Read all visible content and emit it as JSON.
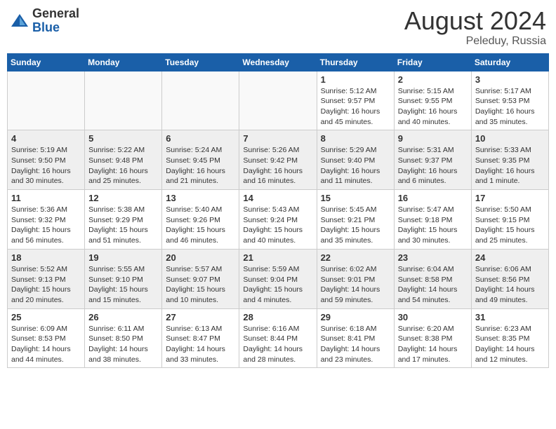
{
  "header": {
    "logo": {
      "general": "General",
      "blue": "Blue"
    },
    "title": "August 2024",
    "subtitle": "Peleduy, Russia"
  },
  "calendar": {
    "weekdays": [
      "Sunday",
      "Monday",
      "Tuesday",
      "Wednesday",
      "Thursday",
      "Friday",
      "Saturday"
    ],
    "weeks": [
      [
        {
          "day": "",
          "info": ""
        },
        {
          "day": "",
          "info": ""
        },
        {
          "day": "",
          "info": ""
        },
        {
          "day": "",
          "info": ""
        },
        {
          "day": "1",
          "info": "Sunrise: 5:12 AM\nSunset: 9:57 PM\nDaylight: 16 hours\nand 45 minutes."
        },
        {
          "day": "2",
          "info": "Sunrise: 5:15 AM\nSunset: 9:55 PM\nDaylight: 16 hours\nand 40 minutes."
        },
        {
          "day": "3",
          "info": "Sunrise: 5:17 AM\nSunset: 9:53 PM\nDaylight: 16 hours\nand 35 minutes."
        }
      ],
      [
        {
          "day": "4",
          "info": "Sunrise: 5:19 AM\nSunset: 9:50 PM\nDaylight: 16 hours\nand 30 minutes."
        },
        {
          "day": "5",
          "info": "Sunrise: 5:22 AM\nSunset: 9:48 PM\nDaylight: 16 hours\nand 25 minutes."
        },
        {
          "day": "6",
          "info": "Sunrise: 5:24 AM\nSunset: 9:45 PM\nDaylight: 16 hours\nand 21 minutes."
        },
        {
          "day": "7",
          "info": "Sunrise: 5:26 AM\nSunset: 9:42 PM\nDaylight: 16 hours\nand 16 minutes."
        },
        {
          "day": "8",
          "info": "Sunrise: 5:29 AM\nSunset: 9:40 PM\nDaylight: 16 hours\nand 11 minutes."
        },
        {
          "day": "9",
          "info": "Sunrise: 5:31 AM\nSunset: 9:37 PM\nDaylight: 16 hours\nand 6 minutes."
        },
        {
          "day": "10",
          "info": "Sunrise: 5:33 AM\nSunset: 9:35 PM\nDaylight: 16 hours\nand 1 minute."
        }
      ],
      [
        {
          "day": "11",
          "info": "Sunrise: 5:36 AM\nSunset: 9:32 PM\nDaylight: 15 hours\nand 56 minutes."
        },
        {
          "day": "12",
          "info": "Sunrise: 5:38 AM\nSunset: 9:29 PM\nDaylight: 15 hours\nand 51 minutes."
        },
        {
          "day": "13",
          "info": "Sunrise: 5:40 AM\nSunset: 9:26 PM\nDaylight: 15 hours\nand 46 minutes."
        },
        {
          "day": "14",
          "info": "Sunrise: 5:43 AM\nSunset: 9:24 PM\nDaylight: 15 hours\nand 40 minutes."
        },
        {
          "day": "15",
          "info": "Sunrise: 5:45 AM\nSunset: 9:21 PM\nDaylight: 15 hours\nand 35 minutes."
        },
        {
          "day": "16",
          "info": "Sunrise: 5:47 AM\nSunset: 9:18 PM\nDaylight: 15 hours\nand 30 minutes."
        },
        {
          "day": "17",
          "info": "Sunrise: 5:50 AM\nSunset: 9:15 PM\nDaylight: 15 hours\nand 25 minutes."
        }
      ],
      [
        {
          "day": "18",
          "info": "Sunrise: 5:52 AM\nSunset: 9:13 PM\nDaylight: 15 hours\nand 20 minutes."
        },
        {
          "day": "19",
          "info": "Sunrise: 5:55 AM\nSunset: 9:10 PM\nDaylight: 15 hours\nand 15 minutes."
        },
        {
          "day": "20",
          "info": "Sunrise: 5:57 AM\nSunset: 9:07 PM\nDaylight: 15 hours\nand 10 minutes."
        },
        {
          "day": "21",
          "info": "Sunrise: 5:59 AM\nSunset: 9:04 PM\nDaylight: 15 hours\nand 4 minutes."
        },
        {
          "day": "22",
          "info": "Sunrise: 6:02 AM\nSunset: 9:01 PM\nDaylight: 14 hours\nand 59 minutes."
        },
        {
          "day": "23",
          "info": "Sunrise: 6:04 AM\nSunset: 8:58 PM\nDaylight: 14 hours\nand 54 minutes."
        },
        {
          "day": "24",
          "info": "Sunrise: 6:06 AM\nSunset: 8:56 PM\nDaylight: 14 hours\nand 49 minutes."
        }
      ],
      [
        {
          "day": "25",
          "info": "Sunrise: 6:09 AM\nSunset: 8:53 PM\nDaylight: 14 hours\nand 44 minutes."
        },
        {
          "day": "26",
          "info": "Sunrise: 6:11 AM\nSunset: 8:50 PM\nDaylight: 14 hours\nand 38 minutes."
        },
        {
          "day": "27",
          "info": "Sunrise: 6:13 AM\nSunset: 8:47 PM\nDaylight: 14 hours\nand 33 minutes."
        },
        {
          "day": "28",
          "info": "Sunrise: 6:16 AM\nSunset: 8:44 PM\nDaylight: 14 hours\nand 28 minutes."
        },
        {
          "day": "29",
          "info": "Sunrise: 6:18 AM\nSunset: 8:41 PM\nDaylight: 14 hours\nand 23 minutes."
        },
        {
          "day": "30",
          "info": "Sunrise: 6:20 AM\nSunset: 8:38 PM\nDaylight: 14 hours\nand 17 minutes."
        },
        {
          "day": "31",
          "info": "Sunrise: 6:23 AM\nSunset: 8:35 PM\nDaylight: 14 hours\nand 12 minutes."
        }
      ]
    ]
  }
}
